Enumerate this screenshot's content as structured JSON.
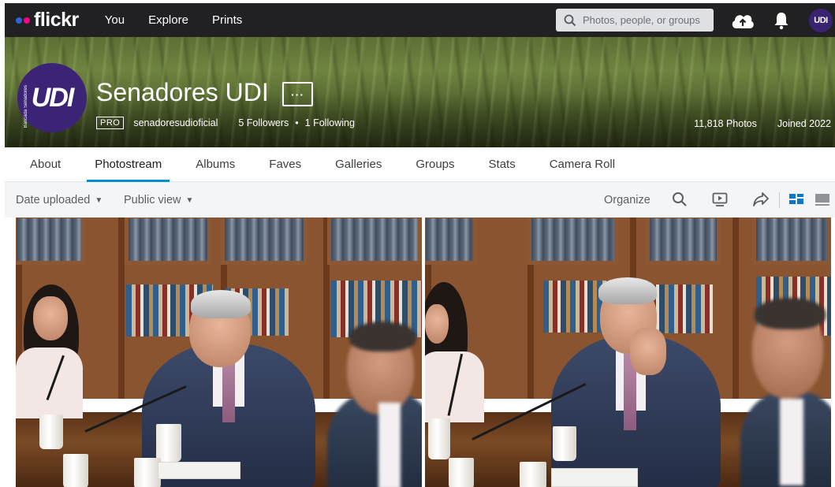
{
  "topnav": {
    "logo": "flickr",
    "links": [
      "You",
      "Explore",
      "Prints"
    ],
    "search_placeholder": "Photos, people, or groups",
    "icons": [
      "search-icon",
      "upload-cloud-icon",
      "notifications-bell-icon"
    ],
    "avatar_text": "UDI"
  },
  "profile": {
    "title": "Senadores UDI",
    "more_label": "···",
    "pro_badge": "PRO",
    "username": "senadoresudioficial",
    "followers": "5 Followers",
    "following": "1 Following",
    "separator": "•",
    "photos_count": "11,818 Photos",
    "joined": "Joined 2022",
    "avatar_text": "UDI",
    "avatar_side_text": "Bancada Senadores"
  },
  "tabs": [
    {
      "label": "About",
      "active": false
    },
    {
      "label": "Photostream",
      "active": true
    },
    {
      "label": "Albums",
      "active": false
    },
    {
      "label": "Faves",
      "active": false
    },
    {
      "label": "Galleries",
      "active": false
    },
    {
      "label": "Groups",
      "active": false
    },
    {
      "label": "Stats",
      "active": false
    },
    {
      "label": "Camera Roll",
      "active": false
    }
  ],
  "toolbar": {
    "sort_label": "Date uploaded",
    "view_label": "Public view",
    "organize_label": "Organize",
    "icons": [
      "search-icon",
      "slideshow-icon",
      "share-icon",
      "grid-view-icon",
      "single-view-icon"
    ]
  },
  "photos": [
    {
      "description": "photo-1"
    },
    {
      "description": "photo-2"
    }
  ],
  "colors": {
    "nav_bg": "#212124",
    "accent": "#008ecf",
    "flickr_blue": "#2a66d6",
    "flickr_pink": "#ff0084",
    "toolbar_bg": "#f3f5f6",
    "udi_purple": "#3b2376"
  }
}
